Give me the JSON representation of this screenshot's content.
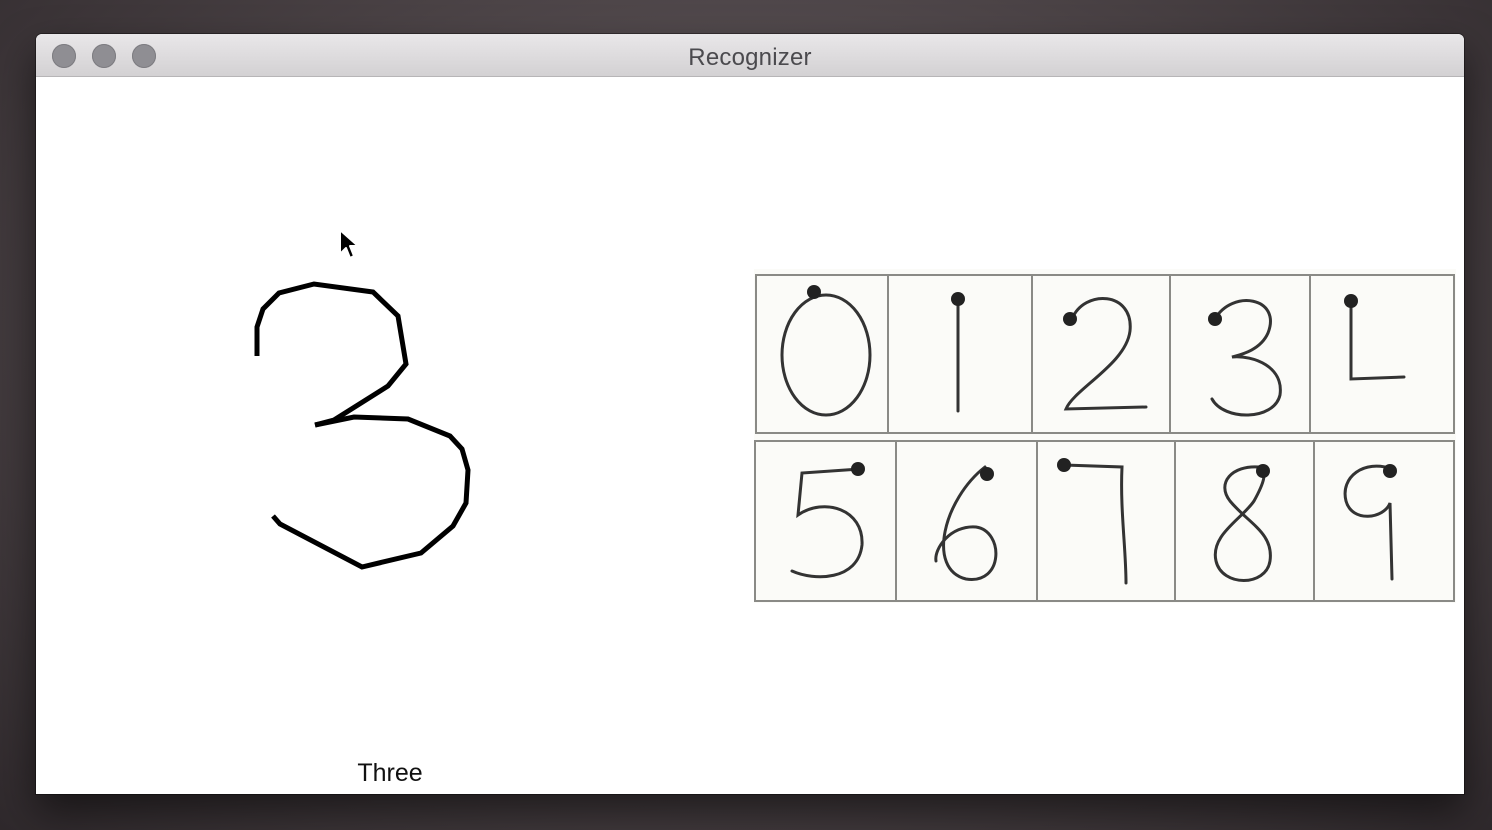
{
  "window": {
    "title": "Recognizer"
  },
  "result": {
    "label": "Three"
  },
  "reference": {
    "row1": [
      "0",
      "1",
      "2",
      "3",
      "4"
    ],
    "row2": [
      "5",
      "6",
      "7",
      "8",
      "9"
    ]
  },
  "colors": {
    "ink": "#000000",
    "titlebar": "#dcdadc",
    "traffic_light": "#8f8e93"
  }
}
